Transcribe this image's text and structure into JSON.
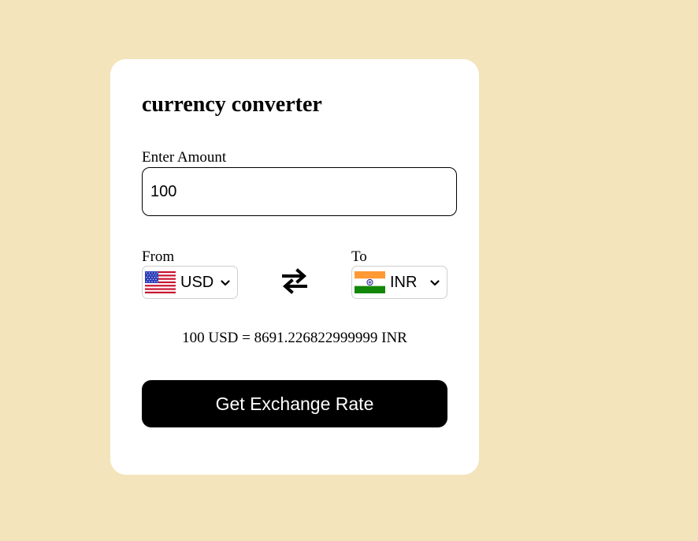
{
  "converter": {
    "title": "currency converter",
    "amount_label": "Enter Amount",
    "amount_value": "100",
    "from_label": "From",
    "to_label": "To",
    "from_currency": "USD",
    "to_currency": "INR",
    "from_flag_icon": "us-flag-icon",
    "to_flag_icon": "india-flag-icon",
    "swap_icon": "swap-arrows-icon",
    "result_text": "100 USD = 8691.226822999999 INR",
    "button_label": "Get Exchange Rate"
  },
  "colors": {
    "page_background": "#f4e4bb",
    "card_background": "#ffffff",
    "button_background": "#000000",
    "button_text": "#ffffff"
  }
}
